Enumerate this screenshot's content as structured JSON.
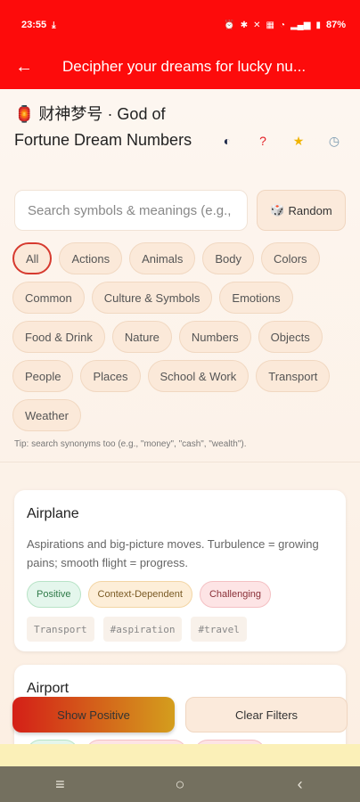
{
  "status_bar": {
    "time": "23:55",
    "battery": "87%"
  },
  "app_bar": {
    "title": "Decipher your dreams for lucky nu..."
  },
  "header": {
    "title_prefix": "🏮",
    "title": "财神梦号 · God of Fortune Dream Numbers"
  },
  "search": {
    "placeholder": "Search symbols & meanings (e.g., ",
    "random_label": "Random"
  },
  "categories": [
    {
      "label": "All",
      "active": true
    },
    {
      "label": "Actions"
    },
    {
      "label": "Animals"
    },
    {
      "label": "Body"
    },
    {
      "label": "Colors"
    },
    {
      "label": "Common"
    },
    {
      "label": "Culture & Symbols"
    },
    {
      "label": "Emotions"
    },
    {
      "label": "Food & Drink"
    },
    {
      "label": "Nature"
    },
    {
      "label": "Numbers"
    },
    {
      "label": "Objects"
    },
    {
      "label": "People"
    },
    {
      "label": "Places"
    },
    {
      "label": "School & Work"
    },
    {
      "label": "Transport"
    },
    {
      "label": "Weather"
    }
  ],
  "tip": "Tip: search synonyms too (e.g., \"money\", \"cash\", \"wealth\").",
  "cards": [
    {
      "name": "Airplane",
      "description": "Aspirations and big-picture moves. Turbulence = growing pains; smooth flight = progress.",
      "tags": [
        "Positive",
        "Context-Dependent",
        "Challenging"
      ],
      "keywords": [
        "Transport",
        "#aspiration",
        "#travel"
      ]
    },
    {
      "name": "Airport",
      "description": "",
      "tags": [],
      "keywords": []
    }
  ],
  "actions": {
    "show_positive": "Show Positive",
    "clear_filters": "Clear Filters"
  },
  "colors": {
    "primary": "#fd0b0b",
    "accent_active": "#d63a2f"
  }
}
